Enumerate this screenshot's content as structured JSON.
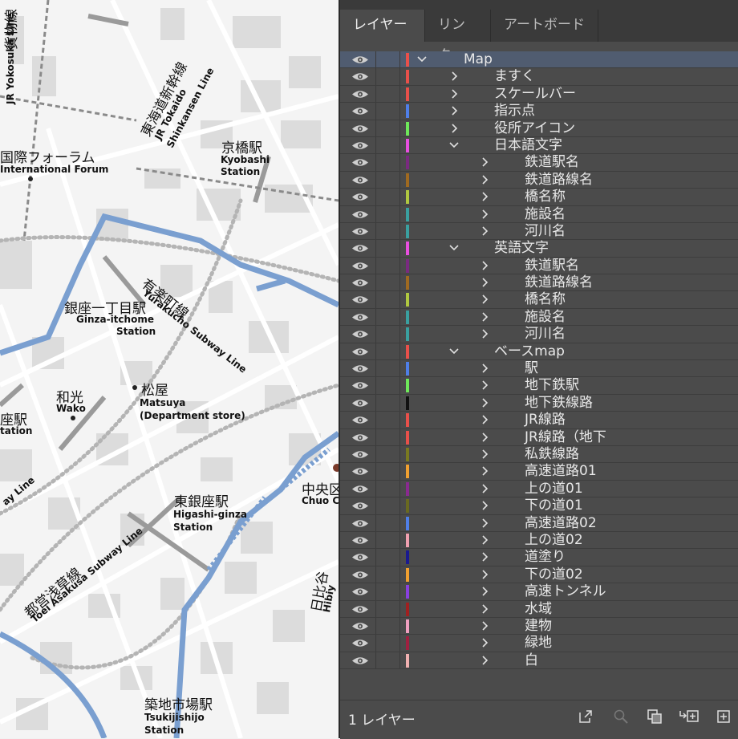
{
  "map": {
    "labels": [
      {
        "id": "jr-yokosuka-line",
        "text": "JR Yokosuka Line"
      },
      {
        "id": "tokaido-shinkansen-ja",
        "text": "東海道新幹線"
      },
      {
        "id": "tokaido-shinkansen-en1",
        "text": "JR Tokaido"
      },
      {
        "id": "tokaido-shinkansen-en2",
        "text": "Shinkansen Line"
      },
      {
        "id": "jr-kamotsu",
        "text": "貨物線"
      },
      {
        "id": "kyobashi-ja",
        "text": "京橋駅"
      },
      {
        "id": "kyobashi-en1",
        "text": "Kyobashi"
      },
      {
        "id": "kyobashi-en2",
        "text": "Station"
      },
      {
        "id": "forum-ja",
        "text": "国際フォーラム"
      },
      {
        "id": "forum-en",
        "text": "International Forum"
      },
      {
        "id": "yurakucho-ja",
        "text": "有楽町線"
      },
      {
        "id": "yurakucho-en",
        "text": "Yurakucho Subway Line"
      },
      {
        "id": "ginza-itchome-ja",
        "text": "銀座一丁目駅"
      },
      {
        "id": "ginza-itchome-en1",
        "text": "Ginza-itchome"
      },
      {
        "id": "ginza-itchome-en2",
        "text": "Station"
      },
      {
        "id": "matsuya-ja",
        "text": "松屋"
      },
      {
        "id": "matsuya-en1",
        "text": "Matsuya"
      },
      {
        "id": "matsuya-en2",
        "text": "(Department store)"
      },
      {
        "id": "wako-ja",
        "text": "和光"
      },
      {
        "id": "wako-en",
        "text": "Wako"
      },
      {
        "id": "ginza-st-ja",
        "text": "座駅"
      },
      {
        "id": "ginza-st-en",
        "text": "tation"
      },
      {
        "id": "subway-line-en",
        "text": "ay Line"
      },
      {
        "id": "higashi-ginza-ja",
        "text": "東銀座駅"
      },
      {
        "id": "higashi-ginza-en1",
        "text": "Higashi-ginza"
      },
      {
        "id": "higashi-ginza-en2",
        "text": "Station"
      },
      {
        "id": "chuo-ja",
        "text": "中央区"
      },
      {
        "id": "chuo-en",
        "text": "Chuo C"
      },
      {
        "id": "asakusa-ja",
        "text": "都営浅草線"
      },
      {
        "id": "asakusa-en",
        "text": "Toei Asakusa Subway Line"
      },
      {
        "id": "hibiya-ja",
        "text": "日比谷"
      },
      {
        "id": "hibiya-en",
        "text": "Hibiy"
      },
      {
        "id": "tsukiji-ja",
        "text": "築地市場駅"
      },
      {
        "id": "tsukiji-en1",
        "text": "Tsukijishijo"
      },
      {
        "id": "tsukiji-en2",
        "text": "Station"
      }
    ]
  },
  "panel": {
    "tabs": [
      "レイヤー",
      "リンク",
      "アートボード"
    ],
    "active_tab": 0,
    "layers": [
      {
        "name": "Map",
        "level": 0,
        "expanded": true,
        "color": "#e8504a",
        "selected": true
      },
      {
        "name": "ますく",
        "level": 1,
        "expanded": false,
        "color": "#e8504a"
      },
      {
        "name": "スケールバー",
        "level": 1,
        "expanded": false,
        "color": "#e8504a"
      },
      {
        "name": "指示点",
        "level": 1,
        "expanded": false,
        "color": "#4f7fe8"
      },
      {
        "name": "役所アイコン",
        "level": 1,
        "expanded": false,
        "color": "#6ee85a"
      },
      {
        "name": "日本語文字",
        "level": 1,
        "expanded": true,
        "color": "#e84fe0"
      },
      {
        "name": "鉄道駅名",
        "level": 2,
        "expanded": false,
        "color": "#7a2a80"
      },
      {
        "name": "鉄道路線名",
        "level": 2,
        "expanded": false,
        "color": "#a06a20"
      },
      {
        "name": "橋名称",
        "level": 2,
        "expanded": false,
        "color": "#b0c840"
      },
      {
        "name": "施設名",
        "level": 2,
        "expanded": false,
        "color": "#3aa0a0"
      },
      {
        "name": "河川名",
        "level": 2,
        "expanded": false,
        "color": "#3aa0a0"
      },
      {
        "name": "英語文字",
        "level": 1,
        "expanded": true,
        "color": "#e84fe0"
      },
      {
        "name": "鉄道駅名",
        "level": 2,
        "expanded": false,
        "color": "#7a2a80"
      },
      {
        "name": "鉄道路線名",
        "level": 2,
        "expanded": false,
        "color": "#a06a20"
      },
      {
        "name": "橋名称",
        "level": 2,
        "expanded": false,
        "color": "#b0c840"
      },
      {
        "name": "施設名",
        "level": 2,
        "expanded": false,
        "color": "#3aa0a0"
      },
      {
        "name": "河川名",
        "level": 2,
        "expanded": false,
        "color": "#3aa0a0"
      },
      {
        "name": "ベースmap",
        "level": 1,
        "expanded": true,
        "color": "#e8504a"
      },
      {
        "name": "駅",
        "level": 2,
        "expanded": false,
        "color": "#4f7fe8"
      },
      {
        "name": "地下鉄駅",
        "level": 2,
        "expanded": false,
        "color": "#6ee85a"
      },
      {
        "name": "地下鉄線路",
        "level": 2,
        "expanded": false,
        "color": "#111111"
      },
      {
        "name": "JR線路",
        "level": 2,
        "expanded": false,
        "color": "#e8504a"
      },
      {
        "name": "JR線路（地下",
        "level": 2,
        "expanded": false,
        "color": "#e8504a"
      },
      {
        "name": "私鉄線路",
        "level": 2,
        "expanded": false,
        "color": "#7a7a20"
      },
      {
        "name": "高速道路01",
        "level": 2,
        "expanded": false,
        "color": "#f0a030"
      },
      {
        "name": "上の道01",
        "level": 2,
        "expanded": false,
        "color": "#8a2a90"
      },
      {
        "name": "下の道01",
        "level": 2,
        "expanded": false,
        "color": "#6a6a20"
      },
      {
        "name": "高速道路02",
        "level": 2,
        "expanded": false,
        "color": "#4f7fe8"
      },
      {
        "name": "上の道02",
        "level": 2,
        "expanded": false,
        "color": "#f0a0b0"
      },
      {
        "name": "道塗り",
        "level": 2,
        "expanded": false,
        "color": "#1a1a90"
      },
      {
        "name": "下の道02",
        "level": 2,
        "expanded": false,
        "color": "#f0a030"
      },
      {
        "name": "高速トンネル",
        "level": 2,
        "expanded": false,
        "color": "#8a40e0"
      },
      {
        "name": "水域",
        "level": 2,
        "expanded": false,
        "color": "#a02020"
      },
      {
        "name": "建物",
        "level": 2,
        "expanded": false,
        "color": "#f0a0c0"
      },
      {
        "name": "緑地",
        "level": 2,
        "expanded": false,
        "color": "#a02040"
      },
      {
        "name": "白",
        "level": 2,
        "expanded": false,
        "color": "#f0b0b0"
      }
    ],
    "footer": {
      "layer_count": "1 レイヤー",
      "icons": [
        "export-icon",
        "search-icon",
        "clipping-mask-icon",
        "new-sublayer-icon",
        "new-layer-icon"
      ]
    }
  }
}
